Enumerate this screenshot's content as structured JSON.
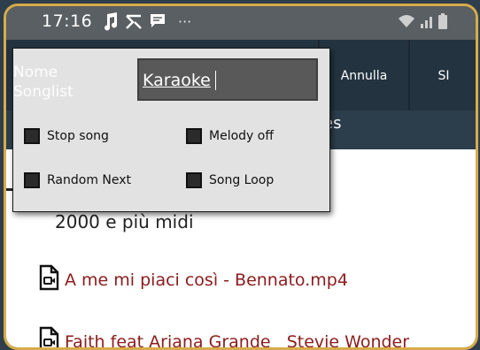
{
  "statusbar": {
    "time": "17:16",
    "notification_more": "···",
    "icons": [
      "music-icon",
      "shuffle-icon",
      "message-icon",
      "wifi-icon",
      "signal-icon",
      "battery-icon"
    ]
  },
  "appbar": {
    "buttons": {
      "cancel": "Annulla",
      "confirm": "SI"
    },
    "subtitle_fragment": "es"
  },
  "dialog": {
    "name_label": "Nome Songlist",
    "name_value": "Karaoke",
    "options": [
      {
        "label": "Stop song",
        "checked": false
      },
      {
        "label": "Melody off",
        "checked": false
      },
      {
        "label": "Random Next",
        "checked": false
      },
      {
        "label": "Song Loop",
        "checked": false
      }
    ]
  },
  "list": {
    "folder": "2000 e più midi",
    "files": [
      {
        "name": "A me mi piaci così - Bennato.mp4",
        "icon": "video-file-icon"
      },
      {
        "name": "Faith feat Ariana Grande   Stevie Wonder",
        "icon": "video-file-icon"
      }
    ]
  },
  "colors": {
    "frame_border": "#d6ac4a",
    "appbar": "#233440",
    "file_text": "#8c1b1b",
    "dialog_bg": "#e2e2e2"
  }
}
